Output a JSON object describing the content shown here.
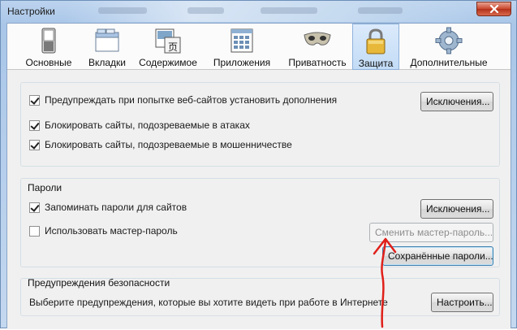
{
  "window": {
    "title": "Настройки"
  },
  "toolbar": {
    "tabs": [
      {
        "label": "Основные",
        "icon": "switch-icon"
      },
      {
        "label": "Вкладки",
        "icon": "tabs-window-icon"
      },
      {
        "label": "Содержимое",
        "icon": "content-icon"
      },
      {
        "label": "Приложения",
        "icon": "applications-icon"
      },
      {
        "label": "Приватность",
        "icon": "mask-icon"
      },
      {
        "label": "Защита",
        "icon": "padlock-icon",
        "active": true
      },
      {
        "label": "Дополнительные",
        "icon": "gear-icon"
      }
    ]
  },
  "general": {
    "warn_addons": {
      "label": "Предупреждать при попытке веб-сайтов установить дополнения",
      "checked": true
    },
    "exceptions_label": "Исключения...",
    "block_attack": {
      "label": "Блокировать сайты, подозреваемые в атаках",
      "checked": true
    },
    "block_forgery": {
      "label": "Блокировать сайты, подозреваемые в мошенничестве",
      "checked": true
    }
  },
  "passwords": {
    "title": "Пароли",
    "remember": {
      "label": "Запоминать пароли для сайтов",
      "checked": true
    },
    "exceptions_label": "Исключения...",
    "master": {
      "label": "Использовать мастер-пароль",
      "checked": false
    },
    "change_master_label": "Сменить мастер-пароль...",
    "saved_label": "Сохранённые пароли..."
  },
  "warnings": {
    "title": "Предупреждения безопасности",
    "description": "Выберите предупреждения, которые вы хотите видеть при работе в Интернете",
    "configure_label": "Настроить..."
  },
  "colors": {
    "annotation_arrow": "#e0201a",
    "active_tab": "#c3dcf6"
  }
}
